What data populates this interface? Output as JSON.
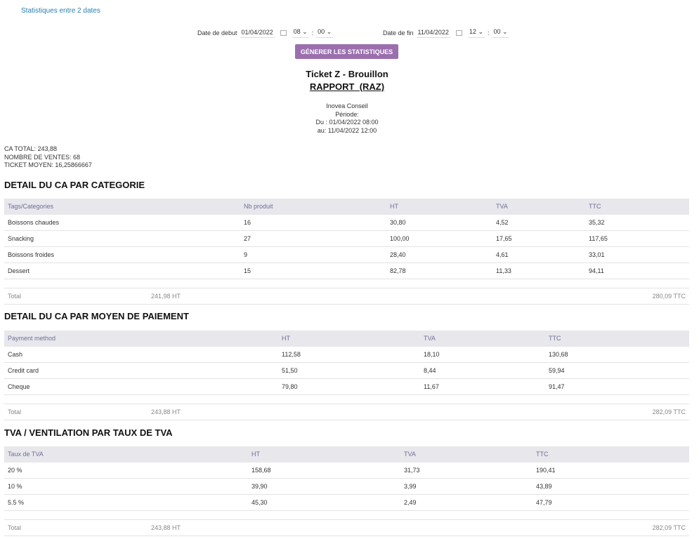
{
  "link": "Statistiques entre 2 dates",
  "start": {
    "label": "Date de debut",
    "date": "01/04/2022",
    "hour": "08",
    "min": "00"
  },
  "end": {
    "label": "Date de fin",
    "date": "11/04/2022",
    "hour": "12",
    "min": "00"
  },
  "button": "GÉNERER LES STATISTIQUES",
  "title1": "Ticket Z - Brouillon",
  "title2": "RAPPORT  (RAZ)",
  "info": [
    "Inovea Conseil",
    "Période:",
    "Du : 01/04/2022 08:00",
    "au: 11/04/2022 12:00"
  ],
  "summary": [
    "CA TOTAL: 243,88",
    "NOMBRE DE VENTES: 68",
    "TICKET MOYEN: 16,25866667"
  ],
  "cat": {
    "title": "DETAIL DU CA PAR CATEGORIE",
    "headers": [
      "Tags/Categories",
      "Nb produit",
      "HT",
      "TVA",
      "TTC"
    ],
    "rows": [
      [
        "Boissons chaudes",
        "16",
        "30,80",
        "4,52",
        "35,32"
      ],
      [
        "Snacking",
        "27",
        "100,00",
        "17,65",
        "117,65"
      ],
      [
        "Boissons froides",
        "9",
        "28,40",
        "4,61",
        "33,01"
      ],
      [
        "Dessert",
        "15",
        "82,78",
        "11,33",
        "94,11"
      ]
    ],
    "total": [
      "Total",
      "241,98 HT",
      "280,09 TTC"
    ]
  },
  "pay": {
    "title": "DETAIL DU CA PAR MOYEN DE PAIEMENT",
    "headers": [
      "Payment method",
      "HT",
      "TVA",
      "TTC"
    ],
    "rows": [
      [
        "Cash",
        "112,58",
        "18,10",
        "130,68"
      ],
      [
        "Credit card",
        "51,50",
        "8,44",
        "59,94"
      ],
      [
        "Cheque",
        "79,80",
        "11,67",
        "91,47"
      ]
    ],
    "total": [
      "Total",
      "243,88 HT",
      "282,09 TTC"
    ]
  },
  "tva": {
    "title": "TVA / VENTILATION PAR TAUX DE TVA",
    "headers": [
      "Taux de TVA",
      "HT",
      "TVA",
      "TTC"
    ],
    "rows": [
      [
        "20 %",
        "158,68",
        "31,73",
        "190,41"
      ],
      [
        "10 %",
        "39,90",
        "3,99",
        "43,89"
      ],
      [
        "5.5 %",
        "45,30",
        "2,49",
        "47,79"
      ]
    ],
    "total": [
      "Total",
      "243,88 HT",
      "282,09 TTC"
    ]
  }
}
